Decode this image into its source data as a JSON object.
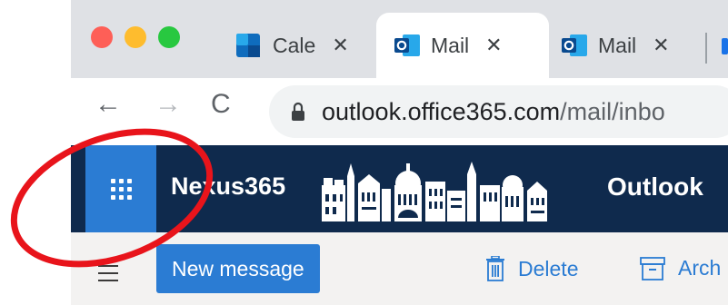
{
  "browser": {
    "tabs": [
      {
        "label": "Cale",
        "close": "✕",
        "icon": "calendar-icon",
        "active": false
      },
      {
        "label": "Mail",
        "close": "✕",
        "icon": "outlook-icon",
        "active": true
      },
      {
        "label": "Mail",
        "close": "✕",
        "icon": "outlook-icon",
        "active": false
      }
    ],
    "nav": {
      "back": "←",
      "forward": "→",
      "reload": "C"
    },
    "url": {
      "host": "outlook.office365.com",
      "path": "/mail/inbo"
    }
  },
  "outlook": {
    "brand": "Nexus365",
    "product": "Outlook",
    "new_message": "New message",
    "delete": "Delete",
    "archive": "Arch"
  },
  "colors": {
    "header_bg": "#0f2a4d",
    "accent": "#2b7cd3",
    "annotation": "#e8141b"
  }
}
